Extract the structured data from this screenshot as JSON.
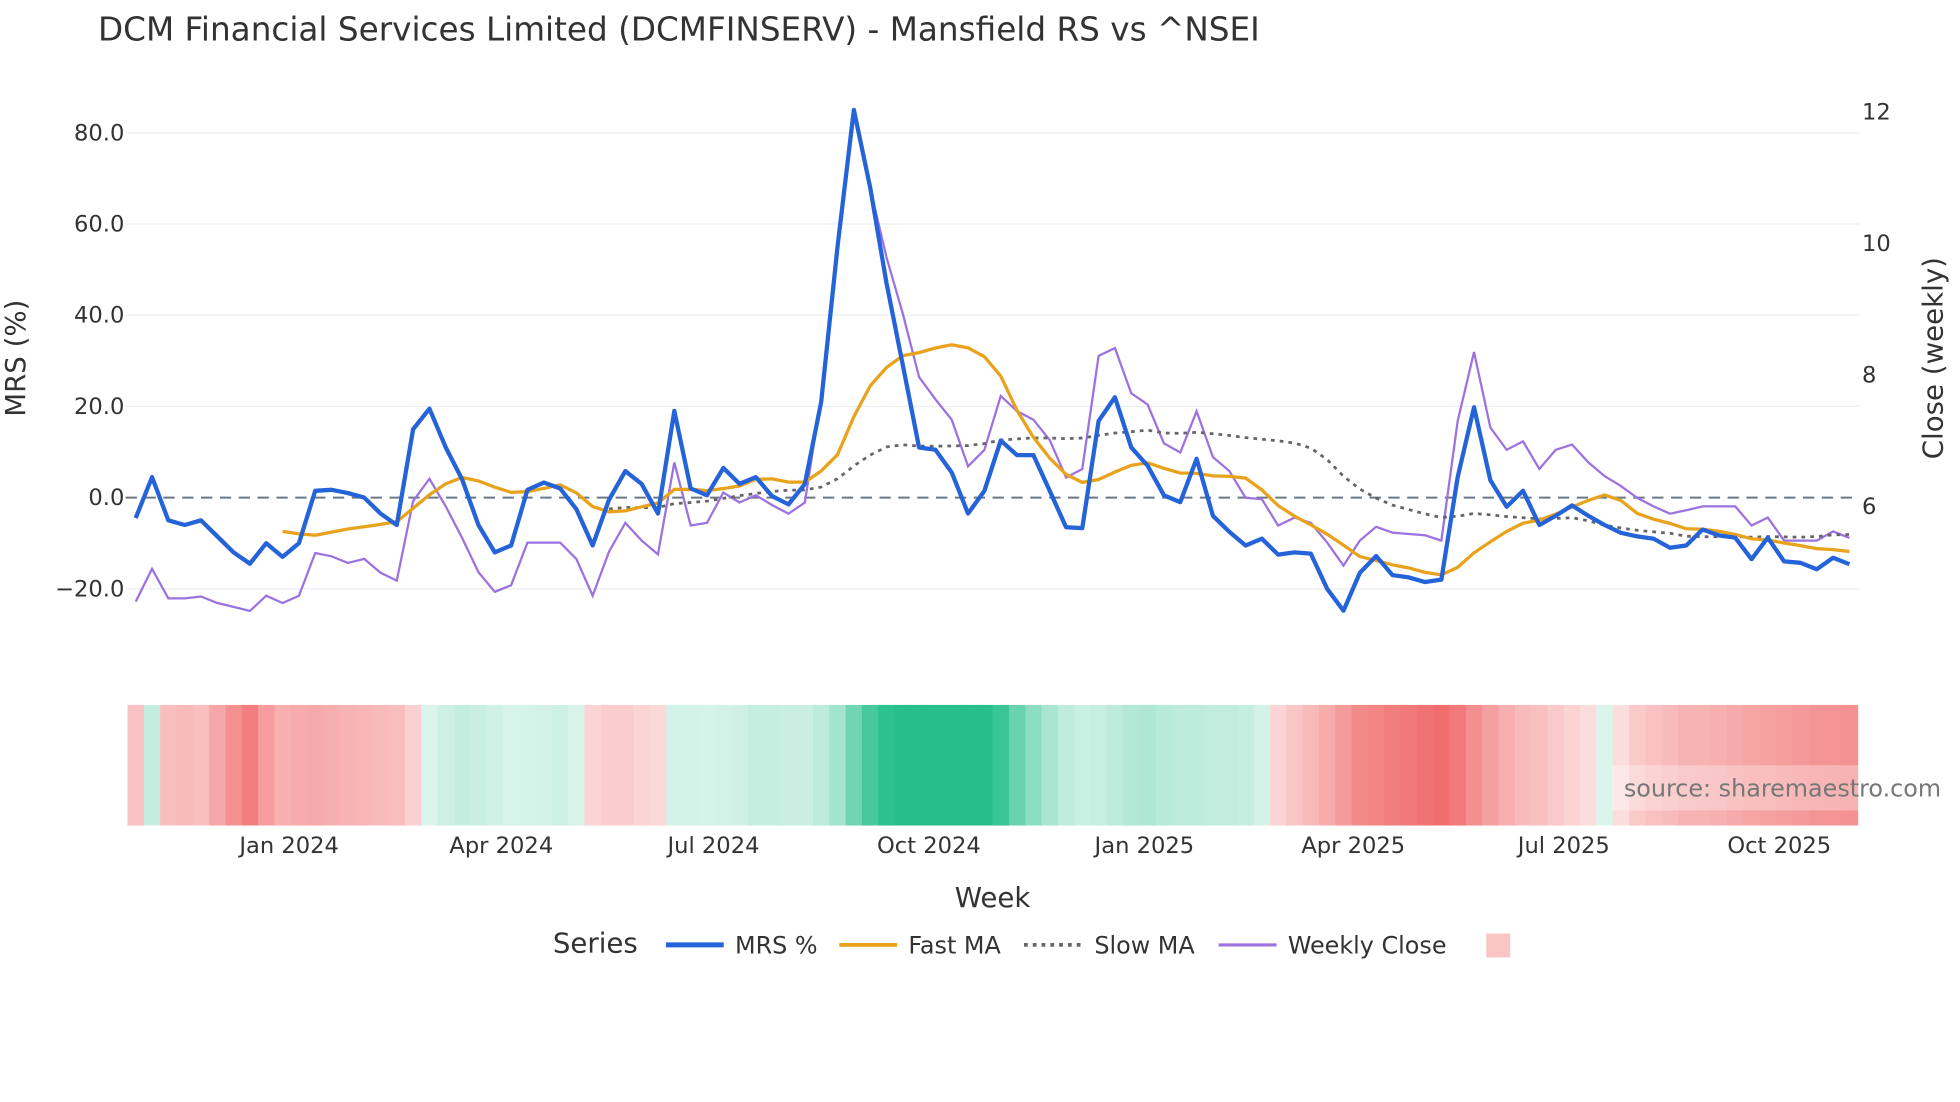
{
  "chart_data": {
    "type": "line",
    "title": "DCM Financial Services Limited (DCMFINSERV) - Mansfield RS vs ^NSEI",
    "xlabel": "Week",
    "ylabel_left": "MRS (%)",
    "ylabel_right": "Close (weekly)",
    "ylim_left": [
      -31,
      90
    ],
    "ylim_right": [
      4.3,
      12.3
    ],
    "yticks_left": [
      80,
      60,
      40,
      20,
      0,
      -20
    ],
    "yticks_left_labels": [
      "80.0",
      "60.0",
      "40.0",
      "20.0",
      "0.0",
      "−20.0"
    ],
    "yticks_right": [
      12,
      10,
      8,
      6
    ],
    "yticks_right_labels": [
      "12",
      "10",
      "8",
      "6"
    ],
    "xticks": [
      {
        "label": "Jan 2024",
        "week_index": 9.4
      },
      {
        "label": "Apr 2024",
        "week_index": 22.4
      },
      {
        "label": "Jul 2024",
        "week_index": 35.4
      },
      {
        "label": "Oct 2024",
        "week_index": 48.6
      },
      {
        "label": "Jan 2025",
        "week_index": 61.8
      },
      {
        "label": "Apr 2025",
        "week_index": 74.6
      },
      {
        "label": "Jul 2025",
        "week_index": 87.5
      },
      {
        "label": "Oct 2025",
        "week_index": 100.7
      }
    ],
    "grid": true,
    "zero_line": "dashed",
    "fast_ma_window": 10,
    "slow_ma_window": 30,
    "series": [
      {
        "name": "MRS %",
        "axis": "left",
        "color": "#2563d9",
        "values": [
          -4.5,
          4.5,
          -5,
          -6,
          -5,
          -8.5,
          -12,
          -14.5,
          -10,
          -13,
          -10,
          1.5,
          1.7,
          1,
          0,
          -3.5,
          -6,
          15,
          19.5,
          11,
          4,
          -6,
          -12,
          -10.5,
          1.7,
          3.3,
          2,
          -2.5,
          -10.5,
          -0.5,
          5.8,
          3,
          -3.5,
          19,
          2,
          0.5,
          6.5,
          3,
          4.5,
          0.3,
          -1.5,
          3,
          21,
          55,
          85,
          68,
          47,
          29,
          11,
          10.5,
          5.5,
          -3.5,
          1.5,
          12.5,
          9.3,
          9.3,
          1.5,
          -6.5,
          -6.7,
          16.8,
          22,
          11,
          7,
          0.5,
          -1,
          8.5,
          -4,
          -7.5,
          -10.5,
          -9,
          -12.5,
          -12,
          -12.3,
          -20,
          -24.8,
          -16.5,
          -12.8,
          -17,
          -17.5,
          -18.5,
          -18,
          4.5,
          19.8,
          3.8,
          -2,
          1.5,
          -6,
          -4,
          -1.7,
          -4,
          -6,
          -7.7,
          -8.5,
          -9,
          -11,
          -10.5,
          -7,
          -8.3,
          -8.8,
          -13.5,
          -8.8,
          -14,
          -14.3,
          -15.7,
          -13.2,
          -14.6
        ]
      },
      {
        "name": "Fast MA",
        "axis": "left",
        "color": "#e8a21c",
        "computed": "SMA of MRS %"
      },
      {
        "name": "Slow MA",
        "axis": "left",
        "color": "#666666",
        "computed": "SMA of MRS %"
      },
      {
        "name": "Weekly Close",
        "axis": "right",
        "color": "#9b72e0",
        "values": [
          4.55,
          5.05,
          4.6,
          4.6,
          4.63,
          4.53,
          4.47,
          4.41,
          4.64,
          4.53,
          4.64,
          5.29,
          5.24,
          5.14,
          5.2,
          4.99,
          4.87,
          6.08,
          6.42,
          6.0,
          5.52,
          5.0,
          4.7,
          4.8,
          5.45,
          5.45,
          5.45,
          5.2,
          4.64,
          5.31,
          5.75,
          5.48,
          5.27,
          6.67,
          5.71,
          5.75,
          6.21,
          6.06,
          6.17,
          6.02,
          5.89,
          6.06,
          7.68,
          9.88,
          12.0,
          10.84,
          9.79,
          8.93,
          7.97,
          7.63,
          7.32,
          6.61,
          6.86,
          7.68,
          7.45,
          7.32,
          7.01,
          6.44,
          6.57,
          8.29,
          8.41,
          7.72,
          7.55,
          6.96,
          6.82,
          7.45,
          6.75,
          6.54,
          6.13,
          6.11,
          5.71,
          5.83,
          5.75,
          5.45,
          5.1,
          5.48,
          5.69,
          5.6,
          5.58,
          5.56,
          5.48,
          7.3,
          8.35,
          7.2,
          6.86,
          6.99,
          6.57,
          6.86,
          6.94,
          6.67,
          6.46,
          6.31,
          6.13,
          6.0,
          5.89,
          5.94,
          6.0,
          6.0,
          6.0,
          5.71,
          5.83,
          5.48,
          5.48,
          5.48,
          5.62,
          5.52
        ]
      }
    ],
    "heatmap_band": {
      "based_on": "Fast MA",
      "positive_color": "#26bf8c",
      "negative_color": "#f06a6a"
    },
    "legend": {
      "title": "Series",
      "placement": "bottom-center",
      "items": [
        "MRS %",
        "Fast MA",
        "Slow MA",
        "Weekly Close",
        ""
      ]
    },
    "annotation": "source: sharemaestro.com"
  }
}
